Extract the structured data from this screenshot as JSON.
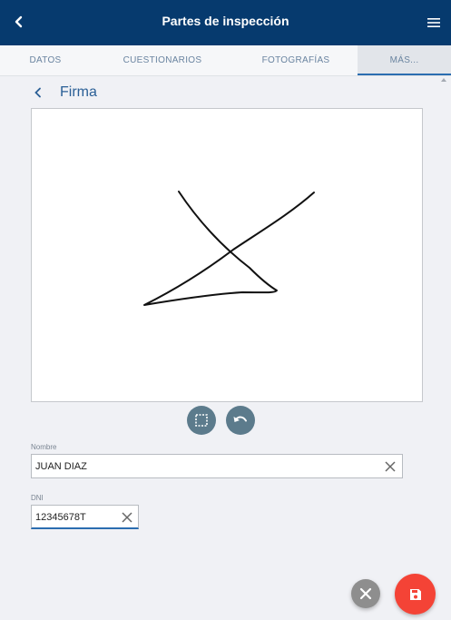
{
  "header": {
    "title": "Partes de inspección",
    "back_icon": "chevron-left-icon",
    "menu_icon": "hamburger-menu-icon",
    "background": "#063a6e"
  },
  "tabs": [
    {
      "label": "DATOS",
      "active": false
    },
    {
      "label": "CUESTIONARIOS",
      "active": false
    },
    {
      "label": "FOTOGRAFÍAS",
      "active": false
    },
    {
      "label": "MÁS...",
      "active": true
    }
  ],
  "section": {
    "title": "Firma",
    "back_icon": "chevron-left-icon"
  },
  "signature_tools": {
    "select_icon": "selection-box-icon",
    "undo_icon": "undo-icon"
  },
  "form": {
    "nombre": {
      "label": "Nombre",
      "value": "JUAN DIAZ",
      "clear_icon": "close-icon"
    },
    "dni": {
      "label": "DNI",
      "value": "12345678T",
      "clear_icon": "close-icon"
    }
  },
  "actions": {
    "cancel_icon": "close-icon",
    "save_icon": "save-floppy-icon",
    "cancel_color": "#8e8e8e",
    "save_color": "#f44336"
  }
}
